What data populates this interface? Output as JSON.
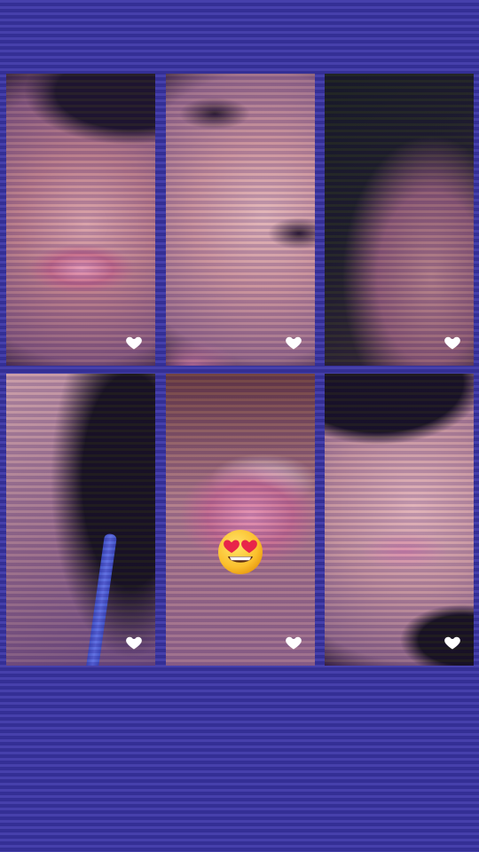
{
  "theme": {
    "background": "#3a34a6",
    "heart_color": "#ffffff"
  },
  "tiles": [
    {
      "label": "",
      "icon": "heart-icon",
      "liked": true
    },
    {
      "label": "",
      "icon": "heart-icon",
      "liked": true
    },
    {
      "label": "",
      "icon": "heart-icon",
      "liked": true
    },
    {
      "label": "",
      "icon": "heart-icon",
      "liked": true
    },
    {
      "label": "",
      "icon": "heart-icon",
      "liked": true,
      "sticker": "heart-eyes-emoji"
    },
    {
      "label": "",
      "icon": "heart-icon",
      "liked": true
    }
  ]
}
